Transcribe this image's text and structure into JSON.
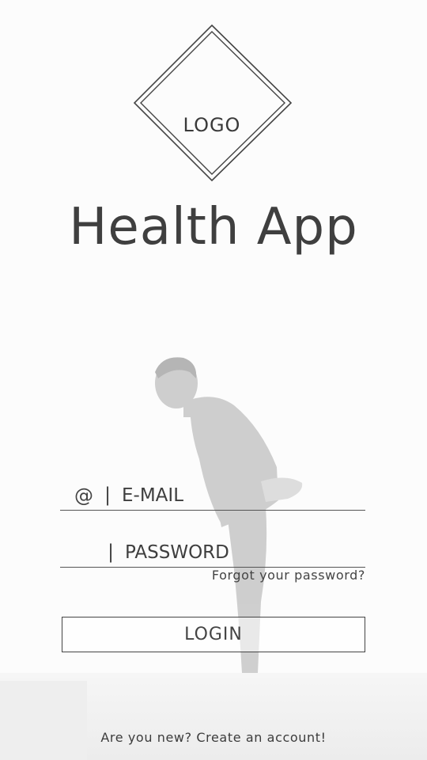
{
  "logo": {
    "text": "LOGO"
  },
  "app": {
    "title": "Health App"
  },
  "email_field": {
    "icon": "at-sign-icon",
    "prefix": "@",
    "separator": "|",
    "placeholder": "E-MAIL",
    "value": ""
  },
  "password_field": {
    "separator": "|",
    "placeholder": "PASSWORD",
    "value": ""
  },
  "forgot_password": {
    "label": "Forgot your password?"
  },
  "login_button": {
    "label": "LOGIN"
  },
  "create_account": {
    "label": "Are you new? Create an account!"
  },
  "colors": {
    "text": "#3f3f3f",
    "border": "#444444",
    "background": "#fcfcfc"
  }
}
